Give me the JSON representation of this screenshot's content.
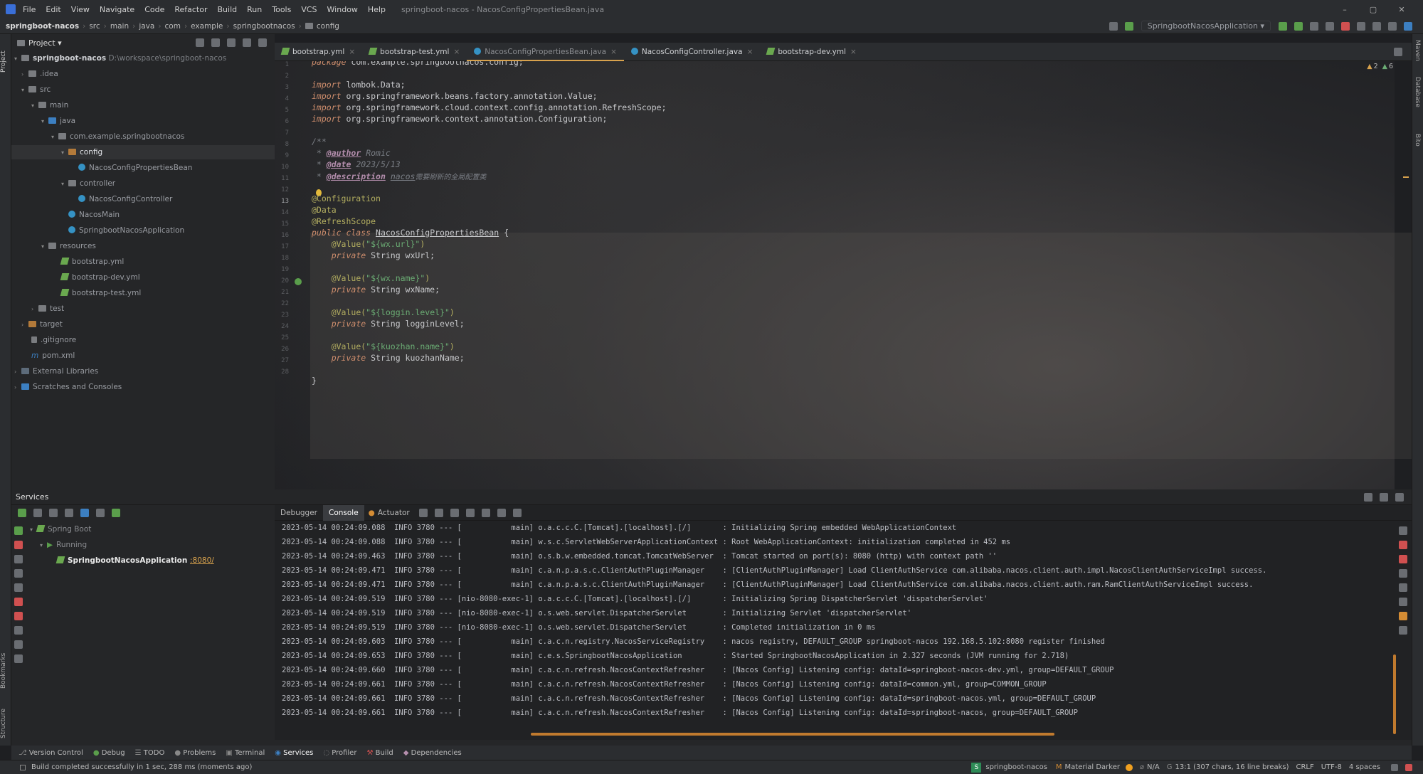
{
  "colors": {
    "accent": "#d8a24d",
    "bg": "#1e1f22",
    "panel": "#2b2d30",
    "keyword": "#cf8e6d",
    "annotation": "#b3ae60",
    "string": "#6aab73"
  },
  "window": {
    "title": "springboot-nacos - NacosConfigPropertiesBean.java",
    "menu": [
      "File",
      "Edit",
      "View",
      "Navigate",
      "Code",
      "Refactor",
      "Build",
      "Run",
      "Tools",
      "VCS",
      "Window",
      "Help"
    ]
  },
  "breadcrumb": [
    "springboot-nacos",
    "src",
    "main",
    "java",
    "com",
    "example",
    "springbootnacos",
    "config"
  ],
  "toolbar": {
    "run_config": "SpringbootNacosApplication"
  },
  "project": {
    "title": "Project",
    "tree": [
      {
        "label": "springboot-nacos",
        "path": "D:\\workspace\\springboot-nacos"
      },
      {
        "label": ".idea"
      },
      {
        "label": "src"
      },
      {
        "label": "main"
      },
      {
        "label": "java"
      },
      {
        "label": "com.example.springbootnacos"
      },
      {
        "label": "config"
      },
      {
        "label": "NacosConfigPropertiesBean"
      },
      {
        "label": "controller"
      },
      {
        "label": "NacosConfigController"
      },
      {
        "label": "NacosMain"
      },
      {
        "label": "SpringbootNacosApplication"
      },
      {
        "label": "resources"
      },
      {
        "label": "bootstrap.yml"
      },
      {
        "label": "bootstrap-dev.yml"
      },
      {
        "label": "bootstrap-test.yml"
      },
      {
        "label": "test"
      },
      {
        "label": "target"
      },
      {
        "label": ".gitignore"
      },
      {
        "label": "pom.xml"
      },
      {
        "label": "External Libraries"
      },
      {
        "label": "Scratches and Consoles"
      }
    ]
  },
  "tabs": [
    "bootstrap.yml",
    "bootstrap-test.yml",
    "NacosConfigPropertiesBean.java",
    "NacosConfigController.java",
    "bootstrap-dev.yml"
  ],
  "editor": {
    "inspections": {
      "warnings": "2",
      "weak": "6"
    },
    "line_numbers": [
      "1",
      "2",
      "3",
      "4",
      "5",
      "6",
      "7",
      "8",
      "9",
      "10",
      "11",
      "12",
      "13",
      "14",
      "15",
      "16",
      "17",
      "18",
      "19",
      "20",
      "21",
      "22",
      "23",
      "24",
      "25",
      "26",
      "27",
      "28"
    ],
    "line_package": "com.example.springbootnacos.config;",
    "imports": [
      "lombok.Data;",
      "org.springframework.beans.factory.annotation.Value;",
      "org.springframework.cloud.context.config.annotation.RefreshScope;",
      "org.springframework.context.annotation.Configuration;"
    ],
    "javadoc": {
      "open": "/**",
      "author_tag": "@author",
      "author": "Romic",
      "date_tag": "@date",
      "date": "2023/5/13",
      "desc_tag": "@description",
      "desc_link": "nacos",
      "desc": "需要刷新的全局配置类"
    },
    "annotations": [
      "@Configuration",
      "@Data",
      "@RefreshScope"
    ],
    "class_decl": {
      "mods": "public class",
      "name": "NacosConfigPropertiesBean",
      "brace": "{"
    },
    "fields": [
      {
        "value_key": "wx.url",
        "decl": "String wxUrl;"
      },
      {
        "value_key": "wx.name",
        "decl": "String wxName;"
      },
      {
        "value_key": "loggin.level",
        "decl": "String logginLevel;"
      },
      {
        "value_key": "kuozhan.name",
        "decl": "String kuozhanName;"
      }
    ],
    "close": "}"
  },
  "services": {
    "title": "Services",
    "tree": [
      "Spring Boot",
      "Running",
      "SpringbootNacosApplication"
    ],
    "port": ":8080/",
    "tabs": [
      "Debugger",
      "Console",
      "Actuator"
    ],
    "logs": [
      "2023-05-14 00:24:09.088  INFO 3780 --- [           main] o.a.c.c.C.[Tomcat].[localhost].[/]       : Initializing Spring embedded WebApplicationContext",
      "2023-05-14 00:24:09.088  INFO 3780 --- [           main] w.s.c.ServletWebServerApplicationContext : Root WebApplicationContext: initialization completed in 452 ms",
      "2023-05-14 00:24:09.463  INFO 3780 --- [           main] o.s.b.w.embedded.tomcat.TomcatWebServer  : Tomcat started on port(s): 8080 (http) with context path ''",
      "2023-05-14 00:24:09.471  INFO 3780 --- [           main] c.a.n.p.a.s.c.ClientAuthPluginManager    : [ClientAuthPluginManager] Load ClientAuthService com.alibaba.nacos.client.auth.impl.NacosClientAuthServiceImpl success.",
      "2023-05-14 00:24:09.471  INFO 3780 --- [           main] c.a.n.p.a.s.c.ClientAuthPluginManager    : [ClientAuthPluginManager] Load ClientAuthService com.alibaba.nacos.client.auth.ram.RamClientAuthServiceImpl success.",
      "2023-05-14 00:24:09.519  INFO 3780 --- [nio-8080-exec-1] o.a.c.c.C.[Tomcat].[localhost].[/]       : Initializing Spring DispatcherServlet 'dispatcherServlet'",
      "2023-05-14 00:24:09.519  INFO 3780 --- [nio-8080-exec-1] o.s.web.servlet.DispatcherServlet        : Initializing Servlet 'dispatcherServlet'",
      "2023-05-14 00:24:09.519  INFO 3780 --- [nio-8080-exec-1] o.s.web.servlet.DispatcherServlet        : Completed initialization in 0 ms",
      "2023-05-14 00:24:09.603  INFO 3780 --- [           main] c.a.c.n.registry.NacosServiceRegistry    : nacos registry, DEFAULT_GROUP springboot-nacos 192.168.5.102:8080 register finished",
      "2023-05-14 00:24:09.653  INFO 3780 --- [           main] c.e.s.SpringbootNacosApplication         : Started SpringbootNacosApplication in 2.327 seconds (JVM running for 2.718)",
      "2023-05-14 00:24:09.660  INFO 3780 --- [           main] c.a.c.n.refresh.NacosContextRefresher    : [Nacos Config] Listening config: dataId=springboot-nacos-dev.yml, group=DEFAULT_GROUP",
      "2023-05-14 00:24:09.661  INFO 3780 --- [           main] c.a.c.n.refresh.NacosContextRefresher    : [Nacos Config] Listening config: dataId=common.yml, group=COMMON_GROUP",
      "2023-05-14 00:24:09.661  INFO 3780 --- [           main] c.a.c.n.refresh.NacosContextRefresher    : [Nacos Config] Listening config: dataId=springboot-nacos.yml, group=DEFAULT_GROUP",
      "2023-05-14 00:24:09.661  INFO 3780 --- [           main] c.a.c.n.refresh.NacosContextRefresher    : [Nacos Config] Listening config: dataId=springboot-nacos, group=DEFAULT_GROUP"
    ]
  },
  "bottom_tools": [
    "Version Control",
    "Debug",
    "TODO",
    "Problems",
    "Terminal",
    "Services",
    "Profiler",
    "Build",
    "Dependencies"
  ],
  "side_labels": {
    "project": "Project",
    "bookmarks": "Bookmarks",
    "structure": "Structure",
    "maven": "Maven",
    "database": "Database",
    "bito": "Bito"
  },
  "status": {
    "message": "Build completed successfully in 1 sec, 288 ms (moments ago)",
    "project": "springboot-nacos",
    "theme": "Material Darker",
    "na": "N/A",
    "position": "13:1 (307 chars, 16 line breaks)",
    "line_sep": "CRLF",
    "encoding": "UTF-8",
    "indent": "4 spaces"
  }
}
